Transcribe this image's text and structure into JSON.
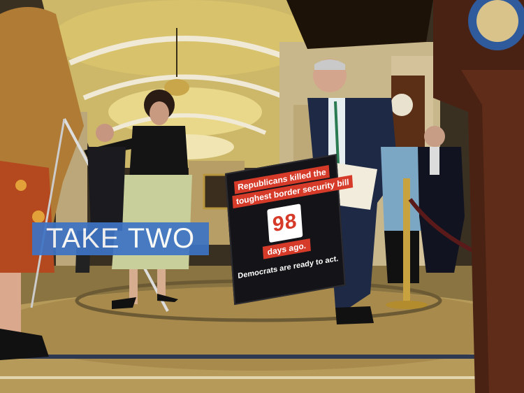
{
  "overlay": {
    "label": "TAKE TWO"
  },
  "sign": {
    "line1": "Republicans killed the",
    "line2": "toughest border security bill",
    "count": "98",
    "days_ago": "days ago.",
    "footer": "Democrats are ready to act."
  },
  "colors": {
    "overlay_blue": "#3d73c4",
    "sign_red": "#d63b2a",
    "sign_black": "#141418"
  }
}
